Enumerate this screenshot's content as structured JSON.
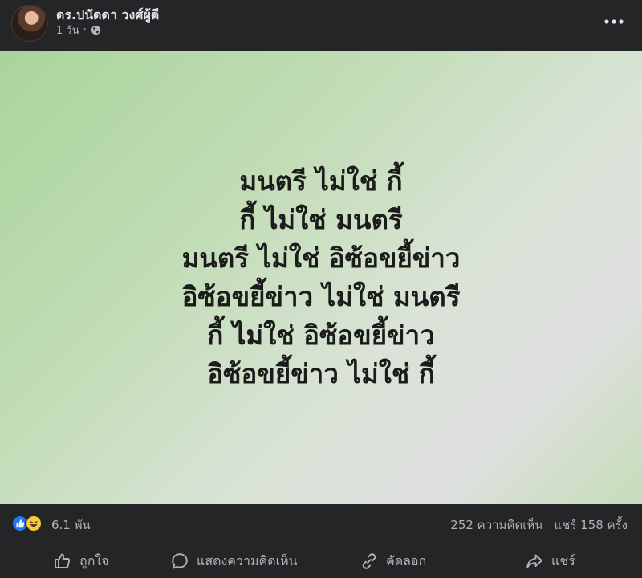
{
  "post": {
    "author": "ดร.ปนัดดา วงศ์ผู้ดี",
    "time": "1 วัน",
    "privacy_icon": "globe-icon",
    "more_icon": "more-horizontal-icon"
  },
  "content": {
    "background_colors": [
      "#a9d49b",
      "#dfe0e0"
    ],
    "lines": [
      "มนตรี ไม่ใช่ กี้",
      "กี้ ไม่ใช่ มนตรี",
      "มนตรี ไม่ใช่ อิซ้อขยี้ข่าว",
      "อิซ้อขยี้ข่าว ไม่ใช่ มนตรี",
      "กี้ ไม่ใช่ อิซ้อขยี้ข่าว",
      "อิซ้อขยี้ข่าว ไม่ใช่ กี้"
    ]
  },
  "summary": {
    "reactions": [
      "like",
      "haha"
    ],
    "reaction_count": "6.1 พัน",
    "comments": "252 ความคิดเห็น",
    "shares": "แชร์ 158 ครั้ง"
  },
  "actions": {
    "like": "ถูกใจ",
    "comment": "แสดงความคิดเห็น",
    "copy": "คัดลอก",
    "share": "แชร์"
  },
  "colors": {
    "background": "#242526",
    "text_primary": "#e4e6eb",
    "text_secondary": "#b0b3b8",
    "like_blue": "#2078f4"
  }
}
